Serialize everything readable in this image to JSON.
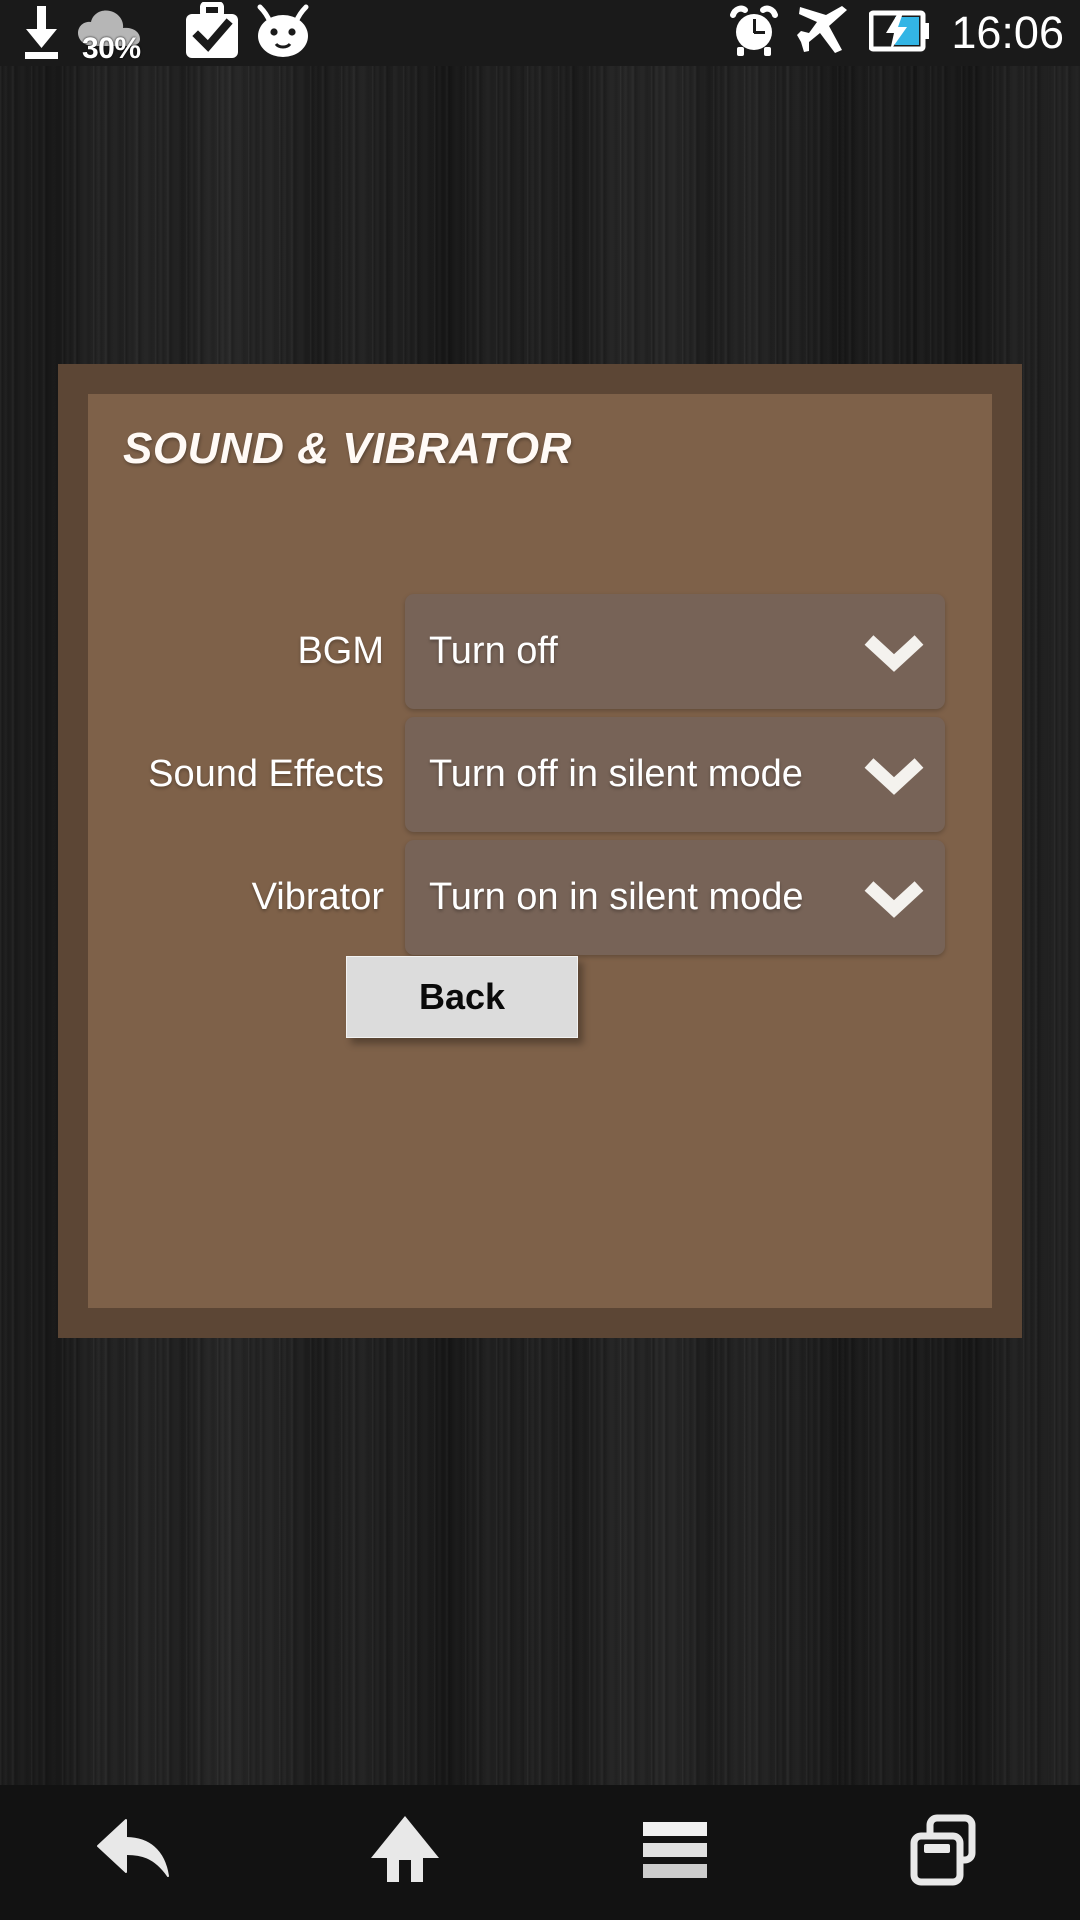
{
  "status_bar": {
    "time": "16:06",
    "battery_percent": "30%",
    "left_icons": [
      {
        "name": "download-icon",
        "label": "download"
      },
      {
        "name": "cloud-icon",
        "label": "cloud"
      },
      {
        "name": "briefcase-check-icon",
        "label": "work-profile"
      },
      {
        "name": "android-head-icon",
        "label": "cyanogenmod"
      }
    ],
    "right_icons": [
      {
        "name": "alarm-clock-icon",
        "label": "alarm"
      },
      {
        "name": "airplane-icon",
        "label": "airplane-mode"
      },
      {
        "name": "battery-charging-icon",
        "label": "charging"
      }
    ]
  },
  "dialog": {
    "title": "SOUND & VIBRATOR",
    "rows": [
      {
        "label": "BGM",
        "value": "Turn off"
      },
      {
        "label": "Sound Effects",
        "value": "Turn off in silent mode"
      },
      {
        "label": "Vibrator",
        "value": "Turn on in silent mode"
      }
    ],
    "back_label": "Back"
  },
  "nav_bar": {
    "buttons": [
      {
        "name": "nav-back-button",
        "label": "Back"
      },
      {
        "name": "nav-home-button",
        "label": "Home"
      },
      {
        "name": "nav-menu-button",
        "label": "Menu"
      },
      {
        "name": "nav-recents-button",
        "label": "Recents"
      }
    ]
  },
  "colors": {
    "panel_border": "#5c4635",
    "panel_fill": "#7e6149",
    "dropdown_fill": "#776357",
    "button_fill": "#dcdcdc",
    "battery_accent": "#33b5e5",
    "status_bar_bg": "#1a1a1a",
    "nav_bar_bg": "#121212"
  }
}
